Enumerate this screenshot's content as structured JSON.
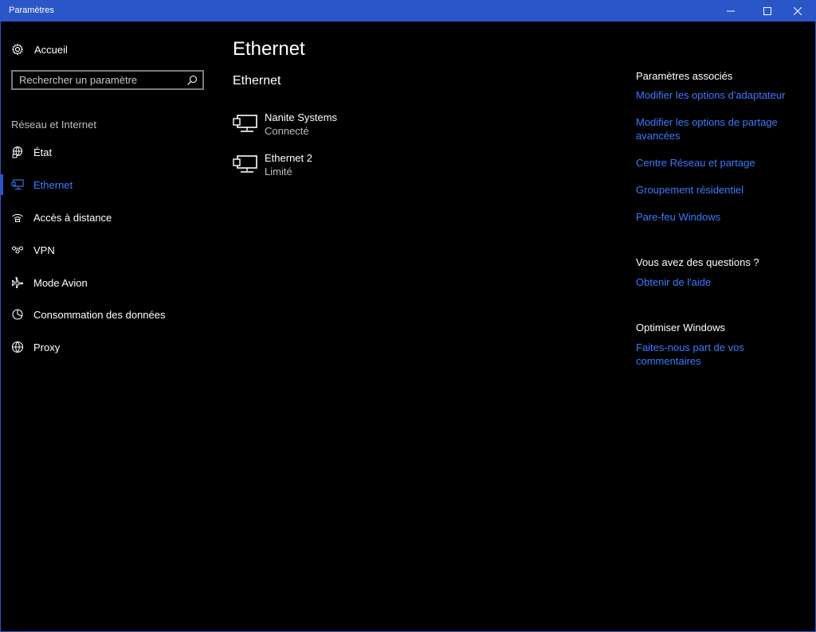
{
  "window": {
    "title": "Paramètres"
  },
  "sidebar": {
    "home_label": "Accueil",
    "search_placeholder": "Rechercher un paramètre",
    "section_label": "Réseau et Internet",
    "items": [
      {
        "label": "État",
        "icon": "globe-status-icon"
      },
      {
        "label": "Ethernet",
        "icon": "ethernet-icon",
        "active": true
      },
      {
        "label": "Accès à distance",
        "icon": "dialup-icon"
      },
      {
        "label": "VPN",
        "icon": "vpn-icon"
      },
      {
        "label": "Mode Avion",
        "icon": "airplane-icon"
      },
      {
        "label": "Consommation des données",
        "icon": "data-usage-icon"
      },
      {
        "label": "Proxy",
        "icon": "globe-icon"
      }
    ]
  },
  "main": {
    "title": "Ethernet",
    "subtitle": "Ethernet",
    "networks": [
      {
        "name": "Nanite Systems",
        "status": "Connecté"
      },
      {
        "name": "Ethernet 2",
        "status": "Limité"
      }
    ]
  },
  "related": {
    "heading": "Paramètres associés",
    "links": [
      "Modifier les options d'adaptateur",
      "Modifier les options de partage avancées",
      "Centre Réseau et partage",
      "Groupement résidentiel",
      "Pare-feu Windows"
    ]
  },
  "questions": {
    "heading": "Vous avez des questions ?",
    "link": "Obtenir de l'aide"
  },
  "optimize": {
    "heading": "Optimiser Windows",
    "link": "Faites-nous part de vos commentaires"
  },
  "colors": {
    "accent": "#2b56c8",
    "link": "#3a7bff",
    "background": "#000000"
  }
}
